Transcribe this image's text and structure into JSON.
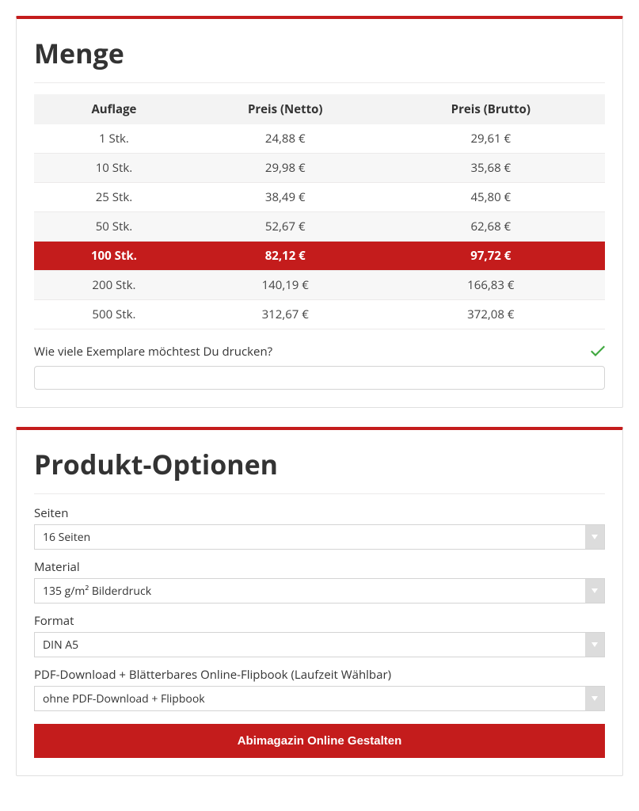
{
  "quantity": {
    "title": "Menge",
    "headers": {
      "qty": "Auflage",
      "net": "Preis (Netto)",
      "gross": "Preis (Brutto)"
    },
    "rows": [
      {
        "qty": "1 Stk.",
        "net": "24,88 €",
        "gross": "29,61 €",
        "selected": false
      },
      {
        "qty": "10 Stk.",
        "net": "29,98 €",
        "gross": "35,68 €",
        "selected": false
      },
      {
        "qty": "25 Stk.",
        "net": "38,49 €",
        "gross": "45,80 €",
        "selected": false
      },
      {
        "qty": "50 Stk.",
        "net": "52,67 €",
        "gross": "62,68 €",
        "selected": false
      },
      {
        "qty": "100 Stk.",
        "net": "82,12 €",
        "gross": "97,72 €",
        "selected": true
      },
      {
        "qty": "200 Stk.",
        "net": "140,19 €",
        "gross": "166,83 €",
        "selected": false
      },
      {
        "qty": "500 Stk.",
        "net": "312,67 €",
        "gross": "372,08 €",
        "selected": false
      }
    ],
    "prompt": "Wie viele Exemplare möchtest Du drucken?",
    "input_value": ""
  },
  "options": {
    "title": "Produkt-Optionen",
    "fields": {
      "pages": {
        "label": "Seiten",
        "value": "16 Seiten"
      },
      "material": {
        "label": "Material",
        "value": "135 g/m² Bilderdruck"
      },
      "format": {
        "label": "Format",
        "value": "DIN A5"
      },
      "flipbook": {
        "label": "PDF-Download + Blätterbares Online-Flipbook (Laufzeit Wählbar)",
        "value": "ohne PDF-Download + Flipbook"
      }
    },
    "cta": "Abimagazin Online Gestalten"
  }
}
